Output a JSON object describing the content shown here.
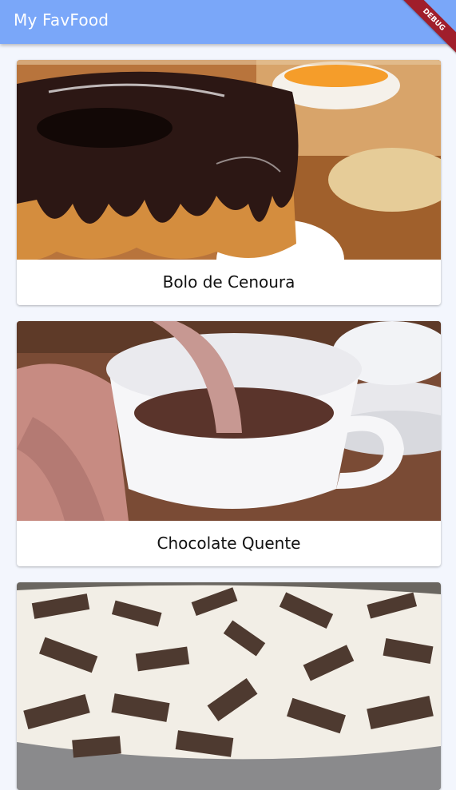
{
  "appbar": {
    "title": "My FavFood",
    "debug_banner": "DEBUG",
    "color": "#7aa7f9"
  },
  "foods": [
    {
      "name": "Bolo de Cenoura",
      "image": "carrot-cake-with-chocolate-icing-photo"
    },
    {
      "name": "Chocolate Quente",
      "image": "hot-chocolate-cup-photo"
    },
    {
      "name": "",
      "image": "pave-dessert-with-wafer-pieces-photo"
    }
  ]
}
